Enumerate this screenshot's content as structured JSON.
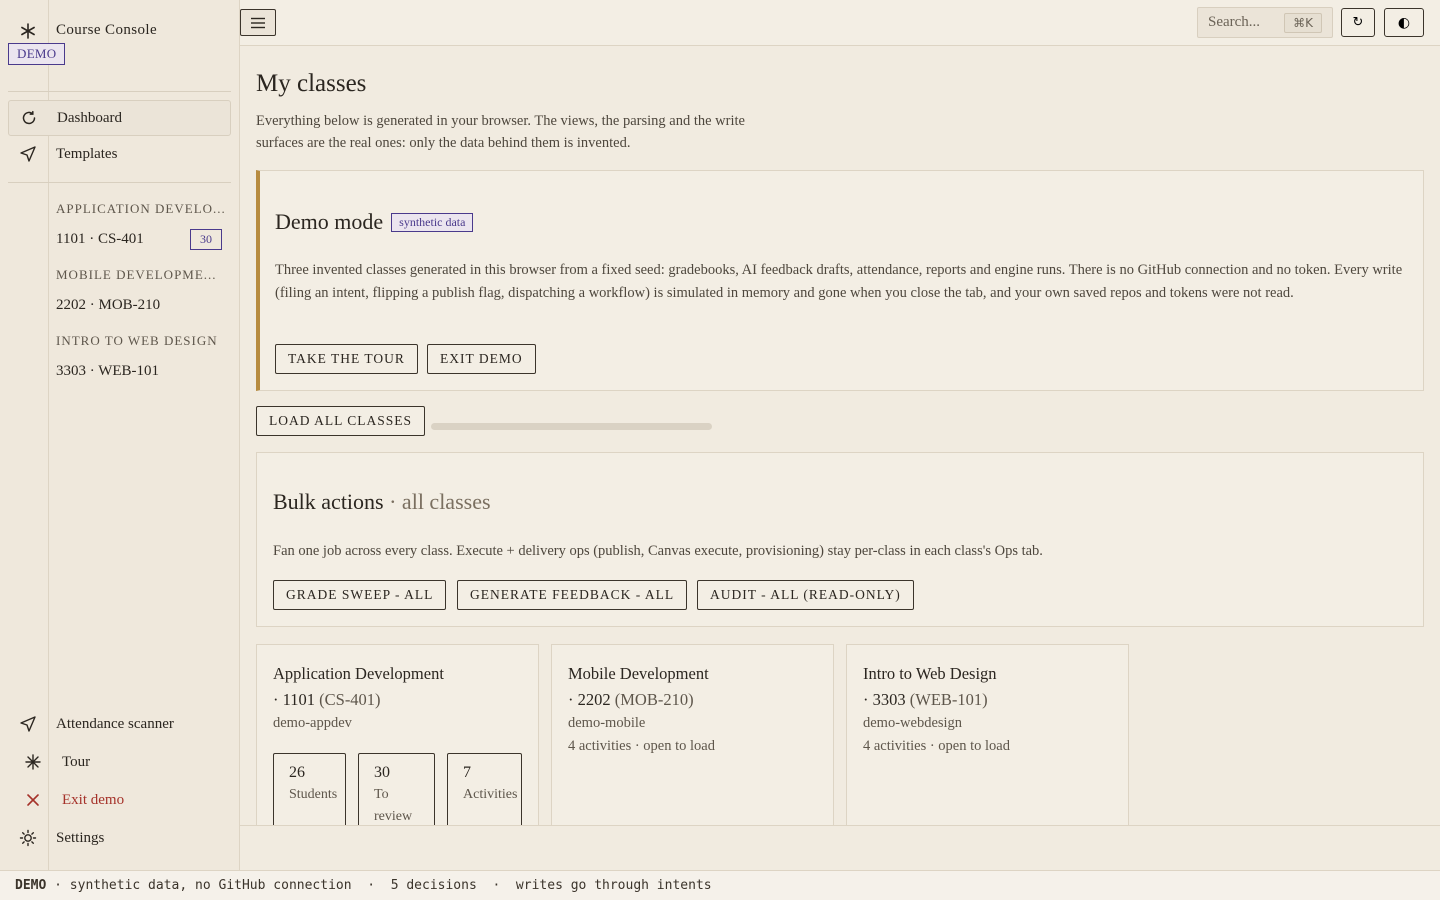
{
  "app": {
    "title": "Course Console",
    "mode_badge": "DEMO"
  },
  "sidebar": {
    "nav": [
      {
        "label": "Dashboard",
        "icon": "refresh-icon",
        "active": true
      },
      {
        "label": "Templates",
        "icon": "send-icon",
        "active": false
      }
    ],
    "groups": [
      {
        "title": "APPLICATION DEVELO...",
        "class_label": "1101 · CS-401",
        "badge": "30"
      },
      {
        "title": "MOBILE DEVELOPME...",
        "class_label": "2202 · MOB-210",
        "badge": ""
      },
      {
        "title": "INTRO TO WEB DESIGN",
        "class_label": "3303 · WEB-101",
        "badge": ""
      }
    ],
    "bottom": [
      {
        "label": "Attendance scanner",
        "icon": "send-icon"
      },
      {
        "label": "Tour",
        "icon": "asterisk-icon"
      },
      {
        "label": "Exit demo",
        "icon": "close-icon"
      },
      {
        "label": "Settings",
        "icon": "sun-icon"
      }
    ]
  },
  "topbar": {
    "search_placeholder": "Search...",
    "search_shortcut": "⌘K",
    "refresh_glyph": "↻",
    "theme_glyph": "◐"
  },
  "main": {
    "title": "My classes",
    "lead": "Everything below is generated in your browser. The views, the parsing and the write surfaces are the real ones: only the data behind them is invented.",
    "demo_card": {
      "title": "Demo mode",
      "tag": "synthetic data",
      "text": "Three invented classes generated in this browser from a fixed seed: gradebooks, AI feedback drafts, attendance, reports and engine runs. There is no GitHub connection and no token. Every write (filing an intent, flipping a publish flag, dispatching a workflow) is simulated in memory and gone when you close the tab, and your own saved repos and tokens were not read.",
      "tour_button": "TAKE THE TOUR",
      "exit_button": "EXIT DEMO"
    },
    "load_all_button": "LOAD ALL CLASSES",
    "load_progress": 0,
    "bulk": {
      "title": "Bulk actions",
      "title_suffix": "· all classes",
      "text": "Fan one job across every class. Execute + delivery ops (publish, Canvas execute, provisioning) stay per-class in each class's Ops tab.",
      "buttons": [
        "GRADE SWEEP - ALL",
        "GENERATE FEEDBACK - ALL",
        "AUDIT - ALL (READ-ONLY)"
      ]
    },
    "classes": [
      {
        "title_line1": "Application Development",
        "title_prefix": "· 1101",
        "title_code": "(CS-401)",
        "repo": "demo-appdev",
        "meta": "",
        "stats": [
          {
            "value": "26",
            "label": "Students"
          },
          {
            "value": "30",
            "label": "To review"
          },
          {
            "value": "7",
            "label": "Activities"
          }
        ]
      },
      {
        "title_line1": "Mobile Development",
        "title_prefix": "· 2202",
        "title_code": "(MOB-210)",
        "repo": "demo-mobile",
        "meta": "4 activities · open to load",
        "stats": []
      },
      {
        "title_line1": "Intro to Web Design",
        "title_prefix": "· 3303",
        "title_code": "(WEB-101)",
        "repo": "demo-webdesign",
        "meta": "4 activities · open to load",
        "stats": []
      }
    ]
  },
  "statusbar": {
    "mode": "DEMO",
    "segments": [
      " · synthetic data, no GitHub connection",
      "  ·  5 decisions",
      "  ·  writes go through intents"
    ]
  }
}
